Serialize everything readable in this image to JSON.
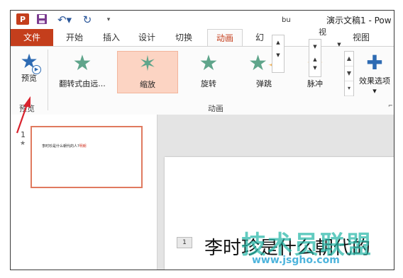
{
  "title_bar": {
    "app_badge": "P",
    "doc_title": "演示文稿1 - Pow"
  },
  "tabs": {
    "file": "文件",
    "home": "开始",
    "insert": "插入",
    "design": "设计",
    "transitions": "切换",
    "animations": "动画",
    "slideshow_partial": "幻",
    "review_partial": "视",
    "view": "视图"
  },
  "ribbon": {
    "preview_label": "预览",
    "preview_group": "预览",
    "animation_group": "动画",
    "effect_options": "效果选项",
    "animations": [
      {
        "label": "翻转式由远...",
        "icon": "flip-in-star",
        "selected": false
      },
      {
        "label": "缩放",
        "icon": "zoom-star",
        "selected": true
      },
      {
        "label": "旋转",
        "icon": "spin-star",
        "selected": false
      },
      {
        "label": "弹跳",
        "icon": "bounce-star",
        "selected": false
      },
      {
        "label": "脉冲",
        "icon": "pulse-star",
        "selected": false
      }
    ]
  },
  "floating": {
    "fragment1": "bu",
    "fragment2": "视"
  },
  "thumbnail": {
    "number": "1",
    "text_main": "李时珍是什么朝代的人?",
    "text_red": "明朝"
  },
  "editor": {
    "anim_tag": "1",
    "slide_text": "李时珍是什么朝代的"
  },
  "watermark": {
    "big": "技术员联盟",
    "small": "www.jsgho.com"
  },
  "colors": {
    "accent": "#c43e1c",
    "star_green": "#5fa58b",
    "star_blue": "#2e6bb3",
    "selected_bg": "#fcd4c3"
  }
}
